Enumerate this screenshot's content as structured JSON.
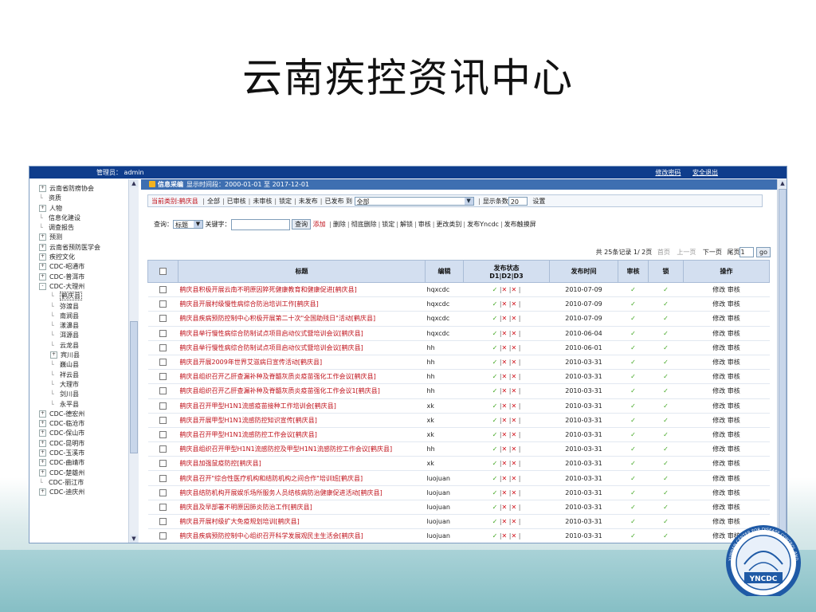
{
  "slide_title": "云南疾控资讯中心",
  "topbar": {
    "admin_label": "管理员： admin",
    "change_password": "修改密码",
    "logout": "安全退出"
  },
  "tree": [
    {
      "label": "云南省防痨协会",
      "expander": "+",
      "level": 0
    },
    {
      "label": "资质",
      "expander": "",
      "level": 0
    },
    {
      "label": "人物",
      "expander": "+",
      "level": 0
    },
    {
      "label": "信息化建设",
      "expander": "",
      "level": 0
    },
    {
      "label": "调查报告",
      "expander": "",
      "level": 0
    },
    {
      "label": "预测",
      "expander": "+",
      "level": 0
    },
    {
      "label": "云南省预防医学会",
      "expander": "+",
      "level": 0
    },
    {
      "label": "疾控文化",
      "expander": "+",
      "level": 0
    },
    {
      "label": "CDC-昭通市",
      "expander": "+",
      "level": 0
    },
    {
      "label": "CDC-普洱市",
      "expander": "+",
      "level": 0
    },
    {
      "label": "CDC-大理州",
      "expander": "-",
      "level": 0
    },
    {
      "label": "鹤庆县",
      "expander": "",
      "level": 1,
      "selected": true
    },
    {
      "label": "弥渡县",
      "expander": "",
      "level": 1
    },
    {
      "label": "南涧县",
      "expander": "",
      "level": 1
    },
    {
      "label": "漾濞县",
      "expander": "",
      "level": 1
    },
    {
      "label": "洱源县",
      "expander": "",
      "level": 1
    },
    {
      "label": "云龙县",
      "expander": "",
      "level": 1
    },
    {
      "label": "宾川县",
      "expander": "+",
      "level": 1
    },
    {
      "label": "巍山县",
      "expander": "",
      "level": 1
    },
    {
      "label": "祥云县",
      "expander": "",
      "level": 1
    },
    {
      "label": "大理市",
      "expander": "",
      "level": 1
    },
    {
      "label": "剑川县",
      "expander": "",
      "level": 1
    },
    {
      "label": "永平县",
      "expander": "",
      "level": 1
    },
    {
      "label": "CDC-德宏州",
      "expander": "+",
      "level": 0
    },
    {
      "label": "CDC-临沧市",
      "expander": "+",
      "level": 0
    },
    {
      "label": "CDC-保山市",
      "expander": "+",
      "level": 0
    },
    {
      "label": "CDC-昆明市",
      "expander": "+",
      "level": 0
    },
    {
      "label": "CDC-玉溪市",
      "expander": "+",
      "level": 0
    },
    {
      "label": "CDC-曲靖市",
      "expander": "+",
      "level": 0
    },
    {
      "label": "CDC-楚雄州",
      "expander": "+",
      "level": 0
    },
    {
      "label": "CDC-丽江市",
      "expander": "",
      "level": 0
    },
    {
      "label": "CDC-迪庆州",
      "expander": "+",
      "level": 0
    }
  ],
  "info_bar": {
    "label": "信息采编",
    "range": "显示时间段：2000-01-01 至 2017-12-01"
  },
  "category_row": {
    "current_label": "当前类别:鹤庆县",
    "filters": [
      "全部",
      "已审核",
      "未审核",
      "锁定",
      "未发布",
      "已发布 到"
    ],
    "select_value": "全部",
    "show_count_label": "显示条数",
    "show_count_value": "20",
    "settings": "设置"
  },
  "query_row": {
    "query_label": "查询：",
    "field_select": "标题",
    "keyword_label": "关键字：",
    "query_button": "查询",
    "add": "添加",
    "actions": [
      "删除",
      "彻底删除",
      "锁定",
      "解锁",
      "审核",
      "更改类别",
      "发布Yncdc",
      "发布触摸屏"
    ]
  },
  "pager": {
    "summary": "共 25条记录 1/ 2页",
    "first": "首页",
    "prev": "上一页",
    "next": "下一页",
    "last": "尾页",
    "page_value": "1",
    "go": "go"
  },
  "columns": {
    "title": "标题",
    "editor": "编辑",
    "publish_state": "发布状态",
    "publish_sub": "D1|D2|D3",
    "publish_time": "发布时间",
    "review": "审核",
    "lock": "锁",
    "ops": "操作"
  },
  "row_ops": {
    "edit": "修改",
    "review": "审核"
  },
  "rows": [
    {
      "title": "鹤庆县积极开展云南不明原因猝死健康教育和健康促进[鹤庆县]",
      "editor": "hqxcdc",
      "date": "2010-07-09"
    },
    {
      "title": "鹤庆县开展村级慢性病综合防治培训工作[鹤庆县]",
      "editor": "hqxcdc",
      "date": "2010-07-09"
    },
    {
      "title": "鹤庆县疾病预防控制中心积极开展第二十次\"全国助残日\"活动[鹤庆县]",
      "editor": "hqxcdc",
      "date": "2010-07-09"
    },
    {
      "title": "鹤庆县举行慢性病综合防制试点项目启动仪式暨培训会议[鹤庆县]",
      "editor": "hqxcdc",
      "date": "2010-06-04"
    },
    {
      "title": "鹤庆县举行慢性病综合防制试点项目启动仪式暨培训会议[鹤庆县]",
      "editor": "hh",
      "date": "2010-06-01"
    },
    {
      "title": "鹤庆县开展2009年世界艾滋病日宣传活动[鹤庆县]",
      "editor": "hh",
      "date": "2010-03-31"
    },
    {
      "title": "鹤庆县组织召开乙肝查漏补种及脊髓灰质炎疫苗强化工作会议[鹤庆县]",
      "editor": "hh",
      "date": "2010-03-31"
    },
    {
      "title": "鹤庆县组织召开乙肝查漏补种及脊髓灰质炎疫苗强化工作会议1[鹤庆县]",
      "editor": "hh",
      "date": "2010-03-31"
    },
    {
      "title": "鹤庆县召开甲型H1N1流感疫苗接种工作培训会[鹤庆县]",
      "editor": "xk",
      "date": "2010-03-31"
    },
    {
      "title": "鹤庆县开展甲型H1N1流感防控知识宣传[鹤庆县]",
      "editor": "xk",
      "date": "2010-03-31"
    },
    {
      "title": "鹤庆县召开甲型H1N1流感防控工作会议[鹤庆县]",
      "editor": "xk",
      "date": "2010-03-31"
    },
    {
      "title": "鹤庆县组织召开甲型H1N1流感防控及甲型H1N1流感防控工作会议[鹤庆县]",
      "editor": "hh",
      "date": "2010-03-31"
    },
    {
      "title": "鹤庆县加强鼠疫防控[鹤庆县]",
      "editor": "xk",
      "date": "2010-03-31"
    },
    {
      "title": "鹤庆县召开\"综合性医疗机构和结防机构之间合作\"培训班[鹤庆县]",
      "editor": "luojuan",
      "date": "2010-03-31"
    },
    {
      "title": "鹤庆县结防机构开展娱乐场所服务人员结核病防治健康促进活动[鹤庆县]",
      "editor": "luojuan",
      "date": "2010-03-31"
    },
    {
      "title": "鹤庆县及早部署不明原因肺炎防治工作[鹤庆县]",
      "editor": "luojuan",
      "date": "2010-03-31"
    },
    {
      "title": "鹤庆县开展村级扩大免疫规划培训[鹤庆县]",
      "editor": "luojuan",
      "date": "2010-03-31"
    },
    {
      "title": "鹤庆县疾病预防控制中心组织召开科学发展观民主生活会[鹤庆县]",
      "editor": "luojuan",
      "date": "2010-03-31"
    }
  ],
  "logo": {
    "text": "YNCDC",
    "ring_text": "YUNNAN CENTER FOR DISEASE CONTROL AND PREVENTION"
  }
}
